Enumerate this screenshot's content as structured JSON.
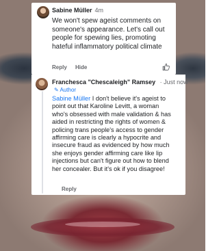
{
  "comment1": {
    "author": "Sabine Müller",
    "time": "4m",
    "text": "We won't spew ageist comments on someone's appearance. Let's call out people for spewing lies, promoting hateful inflammatory political climate",
    "reply_label": "Reply",
    "hide_label": "Hide"
  },
  "comment2": {
    "author": "Franchesca \"Chescaleigh\" Ramsey",
    "time": "Just now",
    "author_badge": "Author",
    "mention": "Sabine Müller",
    "text": " I don't believe it's ageist to point out that Karoline Levitt, a woman who's obsessed with male validation & has aided in restricting the rights of women & policing trans people's access to gender affirming care is clearly a hypocrite and insecure fraud as evidenced by how much she enjoys gender affirming care like lip injections but can't figure out how to blend her concealer. But it's ok if you disagree!",
    "reply_label": "Reply"
  },
  "colors": {
    "link_blue": "#1877f2",
    "meta_gray": "#65676b"
  },
  "icons": {
    "like": "thumbs-up-icon",
    "author_badge": "pencil-icon"
  }
}
